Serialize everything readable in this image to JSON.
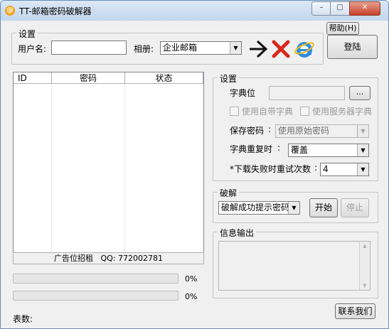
{
  "window": {
    "title": "TT-邮箱密码破解器",
    "icon_glyph": "@",
    "min_glyph": "–",
    "max_glyph": "□",
    "close_glyph": "✕"
  },
  "login_group": {
    "legend": "设置",
    "username_label": "用户名:",
    "username_value": "",
    "mailbox_label": "相册:",
    "mailbox_value": "企业邮箱",
    "help_label": "帮助(H)",
    "login_label": "登陆"
  },
  "toolbar_icons": [
    "arrow-right-icon",
    "red-x-icon",
    "internet-explorer-icon"
  ],
  "list": {
    "columns": [
      "ID",
      "密码",
      "状态"
    ],
    "footer": "广告位招租   QQ: 772002781"
  },
  "progress": [
    {
      "percent_label": "0%",
      "value": 0
    },
    {
      "percent_label": "0%",
      "value": 0
    }
  ],
  "status_text": "表数:",
  "settings": {
    "legend": "设置",
    "dict_label": "字典位",
    "dict_value": "",
    "browse_label": "...",
    "builtin_dict_label": "使用自带字典",
    "server_dict_label": "使用服务器字典",
    "save_pwd_label": "保存密码",
    "save_pwd_colon": ":",
    "save_pwd_value": "使用原始密码",
    "dup_label": "字典重复时",
    "dup_colon": ":",
    "dup_value": "覆盖",
    "retry_label": "*下载失败时重试次数",
    "retry_colon": ":",
    "retry_value": "4"
  },
  "crack": {
    "legend": "破解",
    "mode_value": "破解成功提示密码",
    "start_label": "开始",
    "stop_label": "停止"
  },
  "info": {
    "legend": "信息输出",
    "text": ""
  },
  "contact_label": "联系我们",
  "colors": {
    "progress_fill": "#06b025",
    "titlebar": "#c3d6ec",
    "close_button": "#c8412b"
  }
}
